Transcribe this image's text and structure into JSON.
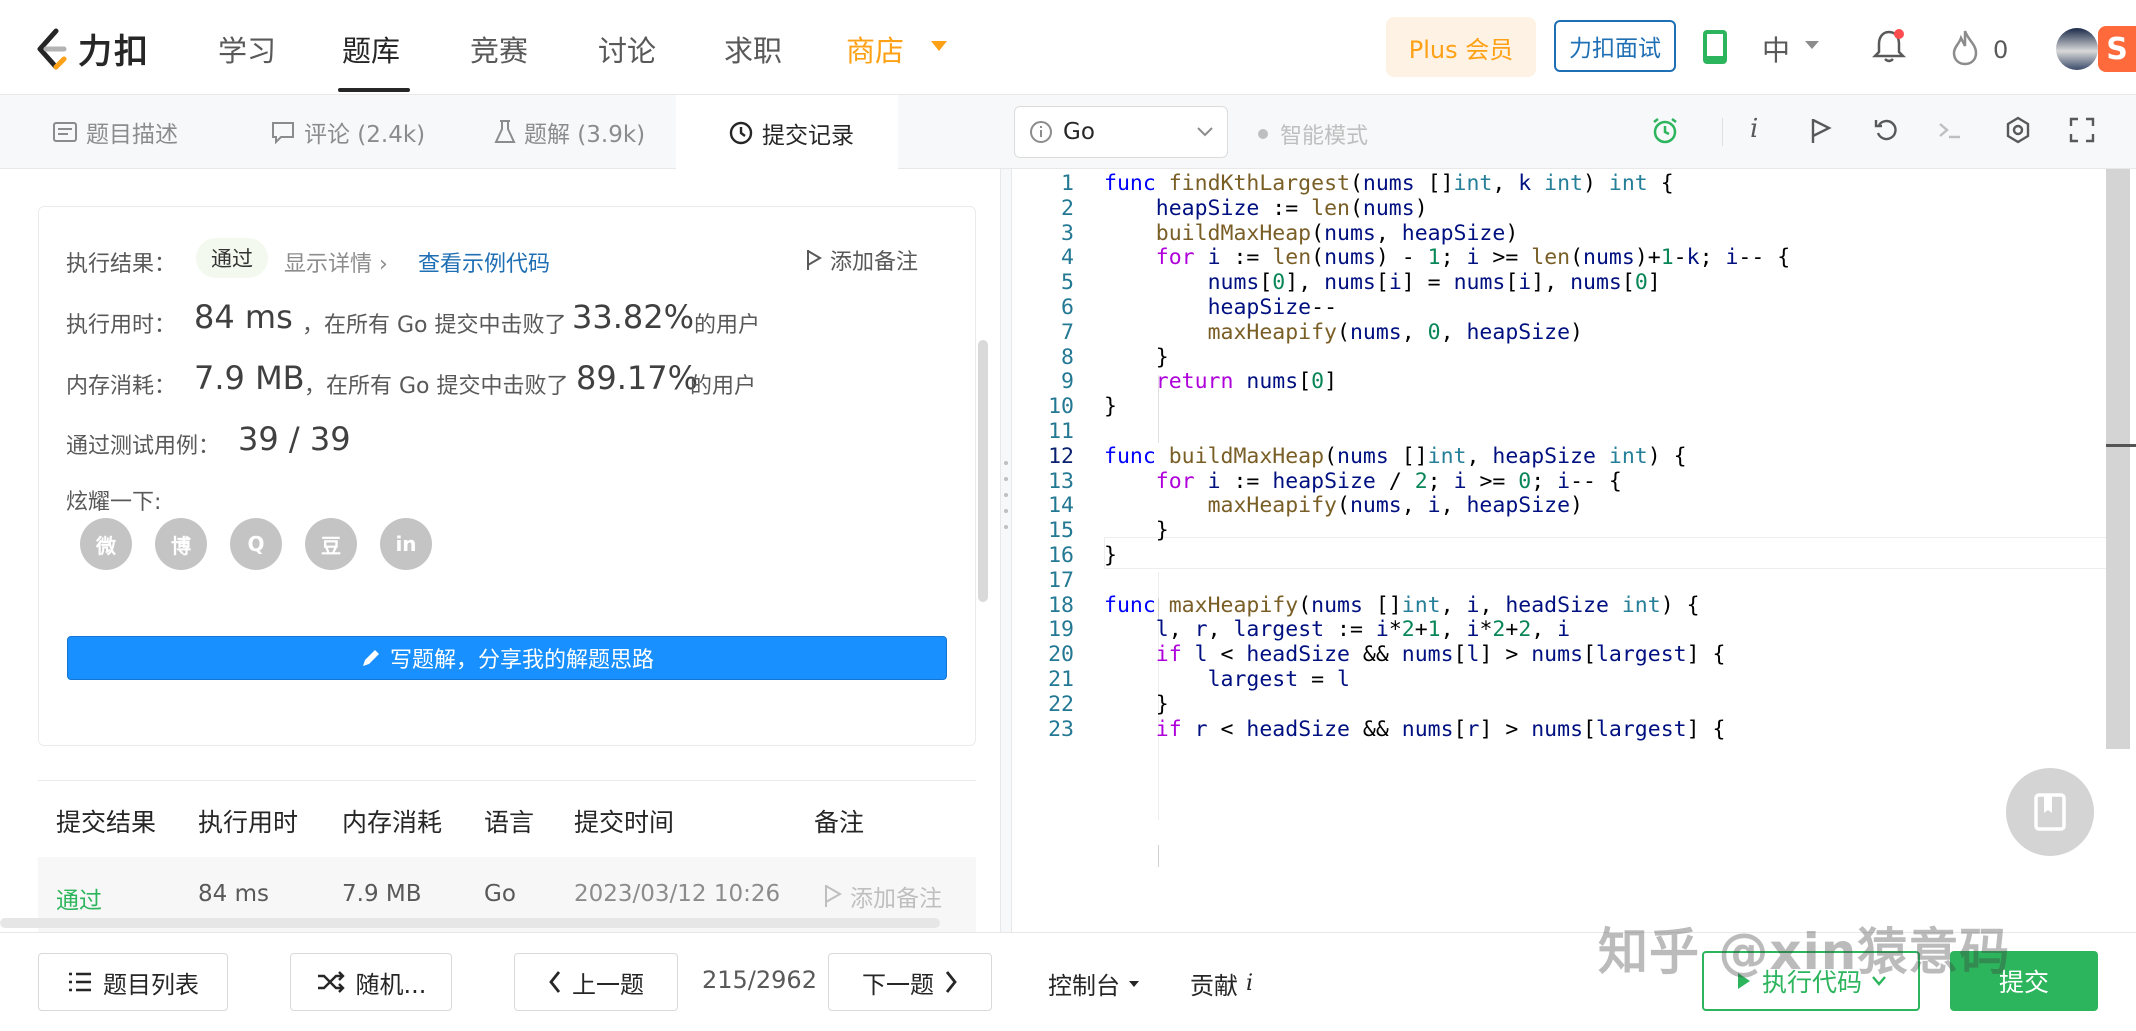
{
  "nav": {
    "logo_text": "力扣",
    "items": [
      "学习",
      "题库",
      "竞赛",
      "讨论",
      "求职",
      "商店"
    ],
    "plus": "Plus 会员",
    "interview": "力扣面试",
    "lang": "中",
    "fire_count": "0"
  },
  "tabs": [
    {
      "label": "题目描述"
    },
    {
      "label": "评论 (2.4k)"
    },
    {
      "label": "题解 (3.9k)"
    },
    {
      "label": "提交记录"
    }
  ],
  "editor_header": {
    "language": "Go",
    "mode": "智能模式"
  },
  "result": {
    "label_result": "执行结果：",
    "status": "通过",
    "show_detail": "显示详情 ›",
    "sample_code": "查看示例代码",
    "add_note": "添加备注",
    "label_time": "执行用时：",
    "time_value": "84 ms",
    "time_text": "，在所有 Go 提交中击败了",
    "time_pct": "33.82%",
    "users_suffix": "的用户",
    "label_mem": "内存消耗：",
    "mem_value": "7.9 MB",
    "mem_text": "，在所有 Go 提交中击败了",
    "mem_pct": "89.17%",
    "label_tests": "通过测试用例：",
    "tests_value": "39 / 39",
    "label_share": "炫耀一下:",
    "social": [
      "微",
      "博",
      "Q",
      "豆",
      "in"
    ],
    "write_btn": "写题解，分享我的解题思路"
  },
  "table": {
    "headers": [
      "提交结果",
      "执行用时",
      "内存消耗",
      "语言",
      "提交时间",
      "备注"
    ],
    "rows": [
      {
        "status": "通过",
        "time": "84 ms",
        "memory": "7.9 MB",
        "lang": "Go",
        "date": "2023/03/12 10:26",
        "note": "添加备注"
      }
    ]
  },
  "code_lines": [
    "1",
    "2",
    "3",
    "4",
    "5",
    "6",
    "7",
    "8",
    "9",
    "10",
    "11",
    "12",
    "13",
    "14",
    "15",
    "16",
    "17",
    "18",
    "19",
    "20",
    "21",
    "22",
    "23"
  ],
  "code_text": [
    "func findKthLargest(nums []int, k int) int {",
    "    heapSize := len(nums)",
    "    buildMaxHeap(nums, heapSize)",
    "    for i := len(nums) - 1; i >= len(nums)+1-k; i-- {",
    "        nums[0], nums[i] = nums[i], nums[0]",
    "        heapSize--",
    "        maxHeapify(nums, 0, heapSize)",
    "    }",
    "    return nums[0]",
    "}",
    "",
    "func buildMaxHeap(nums []int, heapSize int) {",
    "    for i := heapSize / 2; i >= 0; i-- {",
    "        maxHeapify(nums, i, heapSize)",
    "    }",
    "}",
    "",
    "func maxHeapify(nums []int, i, headSize int) {",
    "    l, r, largest := i*2+1, i*2+2, i",
    "    if l < headSize && nums[l] > nums[largest] {",
    "        largest = l",
    "    }",
    "    if r < headSize && nums[r] > nums[largest] {"
  ],
  "bottom": {
    "problem_list": "题目列表",
    "random": "随机...",
    "prev": "上一题",
    "progress": "215/2962",
    "next": "下一题",
    "console": "控制台",
    "contribute": "贡献",
    "run": "执行代码",
    "submit": "提交"
  },
  "watermark": "知乎 @xin猿意码",
  "colors": {
    "accent": "#2db55d",
    "store": "#ffa116",
    "link": "#1f6fb5",
    "button_blue": "#1890ff"
  }
}
